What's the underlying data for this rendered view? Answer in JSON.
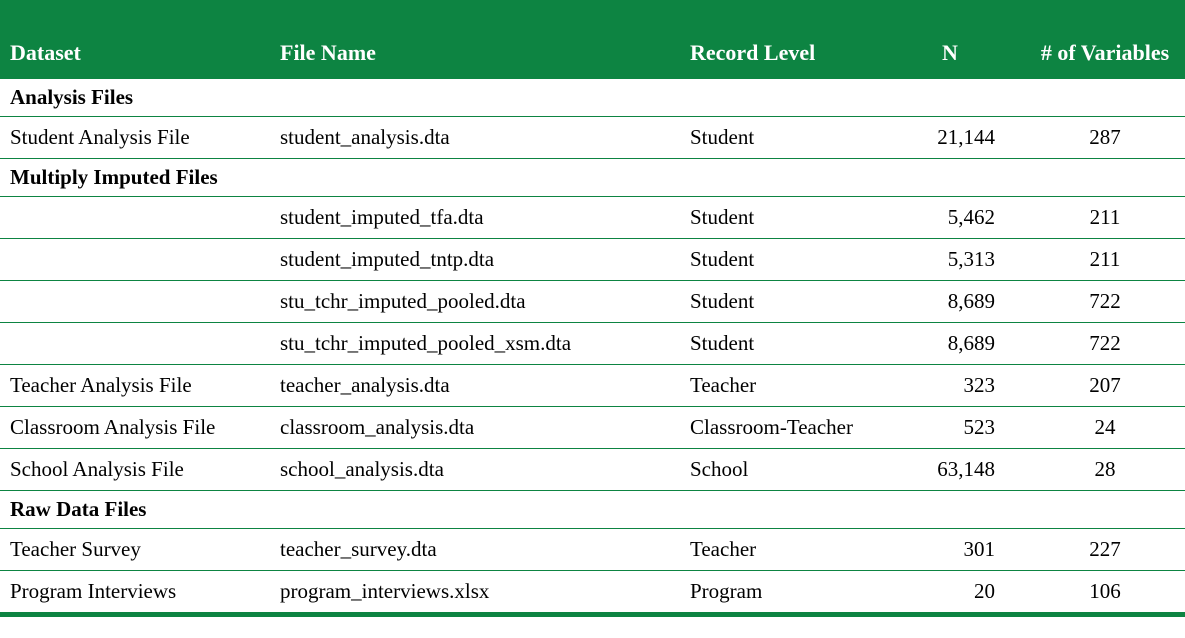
{
  "headers": {
    "dataset": "Dataset",
    "filename": "File Name",
    "recordlevel": "Record Level",
    "n": "N",
    "vars": "# of Variables"
  },
  "sections": [
    {
      "title": "Analysis Files",
      "rows": [
        {
          "dataset": "Student Analysis File",
          "filename": "student_analysis.dta",
          "level": "Student",
          "n": "21,144",
          "vars": "287"
        }
      ]
    },
    {
      "title": "Multiply Imputed Files",
      "rows": [
        {
          "dataset": "",
          "filename": "student_imputed_tfa.dta",
          "level": "Student",
          "n": "5,462",
          "vars": "211"
        },
        {
          "dataset": "",
          "filename": "student_imputed_tntp.dta",
          "level": "Student",
          "n": "5,313",
          "vars": "211"
        },
        {
          "dataset": "",
          "filename": "stu_tchr_imputed_pooled.dta",
          "level": "Student",
          "n": "8,689",
          "vars": "722"
        },
        {
          "dataset": "",
          "filename": "stu_tchr_imputed_pooled_xsm.dta",
          "level": "Student",
          "n": "8,689",
          "vars": "722"
        },
        {
          "dataset": "Teacher Analysis File",
          "filename": "teacher_analysis.dta",
          "level": "Teacher",
          "n": "323",
          "vars": "207"
        },
        {
          "dataset": "Classroom Analysis File",
          "filename": "classroom_analysis.dta",
          "level": "Classroom-Teacher",
          "n": "523",
          "vars": "24"
        },
        {
          "dataset": "School Analysis File",
          "filename": "school_analysis.dta",
          "level": "School",
          "n": "63,148",
          "vars": "28"
        }
      ]
    },
    {
      "title": "Raw Data Files",
      "rows": [
        {
          "dataset": "Teacher Survey",
          "filename": "teacher_survey.dta",
          "level": "Teacher",
          "n": "301",
          "vars": "227"
        },
        {
          "dataset": "Program Interviews",
          "filename": "program_interviews.xlsx",
          "level": "Program",
          "n": "20",
          "vars": "106"
        }
      ]
    }
  ]
}
